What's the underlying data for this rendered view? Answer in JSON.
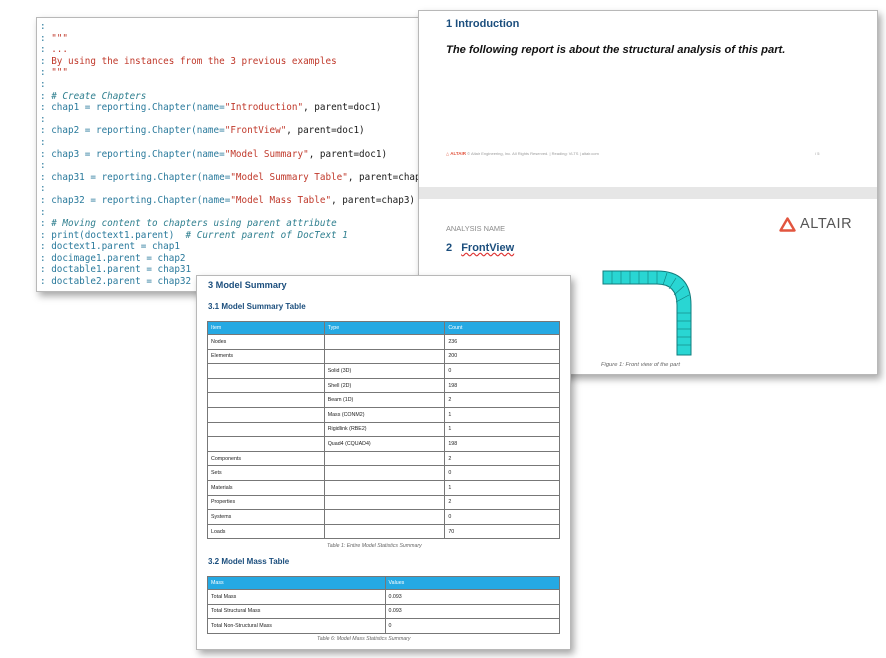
{
  "code_lines": [
    {
      "t": ":"
    },
    {
      "t": ": ",
      "s": "\"\"\""
    },
    {
      "t": ": ",
      "s": "..."
    },
    {
      "t": ": ",
      "s": "By using the instances from the 3 previous examples"
    },
    {
      "t": ": ",
      "s": "\"\"\""
    },
    {
      "t": ":"
    },
    {
      "t": ": ",
      "c": "# Create Chapters"
    },
    {
      "t": ": chap1 = reporting.Chapter(name=",
      "s": "\"Introduction\"",
      "r": ", parent=doc1)"
    },
    {
      "t": ":"
    },
    {
      "t": ": chap2 = reporting.Chapter(name=",
      "s": "\"FrontView\"",
      "r": ", parent=doc1)"
    },
    {
      "t": ":"
    },
    {
      "t": ": chap3 = reporting.Chapter(name=",
      "s": "\"Model Summary\"",
      "r": ", parent=doc1)"
    },
    {
      "t": ":"
    },
    {
      "t": ": chap31 = reporting.Chapter(name=",
      "s": "\"Model Summary Table\"",
      "r": ", parent=chap3)"
    },
    {
      "t": ":"
    },
    {
      "t": ": chap32 = reporting.Chapter(name=",
      "s": "\"Model Mass Table\"",
      "r": ", parent=chap3)"
    },
    {
      "t": ":"
    },
    {
      "t": ": ",
      "c": "# Moving content to chapters using parent attribute"
    },
    {
      "t": ": print(doctext1.parent)  ",
      "c": "# Current parent of DocText 1"
    },
    {
      "t": ": doctext1.parent = chap1"
    },
    {
      "t": ": docimage1.parent = chap2"
    },
    {
      "t": ": doctable1.parent = chap31"
    },
    {
      "t": ": doctable2.parent = chap32"
    }
  ],
  "report": {
    "intro_heading": "1   Introduction",
    "intro_text": "The following report is about the structural analysis of this part.",
    "footer_logo": "ALTAIR",
    "footer_text": "© Altair Engineering, Inc. All Rights Reserved.  |  Reading: VLTS  |  altair.com",
    "footer_page": "/ 5",
    "analysis_name": "ANALYSIS NAME",
    "brand": "ALTAIR",
    "front_heading_num": "2",
    "front_heading_text": "FrontView",
    "figure_caption": "Figure 1: Front view of the part"
  },
  "summary": {
    "h3": "3   Model Summary",
    "h31": "3.1   Model Summary Table",
    "t1_headers": [
      "Item",
      "Type",
      "Count"
    ],
    "t1_rows": [
      [
        "Nodes",
        "",
        "236"
      ],
      [
        "Elements",
        "",
        "200"
      ],
      [
        "",
        "Solid (3D)",
        "0"
      ],
      [
        "",
        "Shell (2D)",
        "198"
      ],
      [
        "",
        "Beam (1D)",
        "2"
      ],
      [
        "",
        "Mass (CONM2)",
        "1"
      ],
      [
        "",
        "Rigidlink (RBE2)",
        "1"
      ],
      [
        "",
        "Quad4 (CQUAD4)",
        "198"
      ],
      [
        "Components",
        "",
        "2"
      ],
      [
        "Sets",
        "",
        "0"
      ],
      [
        "Materials",
        "",
        "1"
      ],
      [
        "Properties",
        "",
        "2"
      ],
      [
        "Systems",
        "",
        "0"
      ],
      [
        "Loads",
        "",
        "70"
      ]
    ],
    "t1_caption": "Table 1: Entire Model Statistics Summary",
    "h32": "3.2   Model Mass Table",
    "t2_headers": [
      "Mass",
      "Values"
    ],
    "t2_rows": [
      [
        "Total Mass",
        "0.093"
      ],
      [
        "Total Structural Mass",
        "0.093"
      ],
      [
        "Total Non-Structural Mass",
        "0"
      ]
    ],
    "t2_caption": "Table 6: Model Mass Statistics Summary"
  },
  "colors": {
    "heading": "#1b4e7d",
    "table_header": "#25a9e3",
    "brand_orange": "#e2553f",
    "mesh_cyan": "#29d6d3"
  }
}
